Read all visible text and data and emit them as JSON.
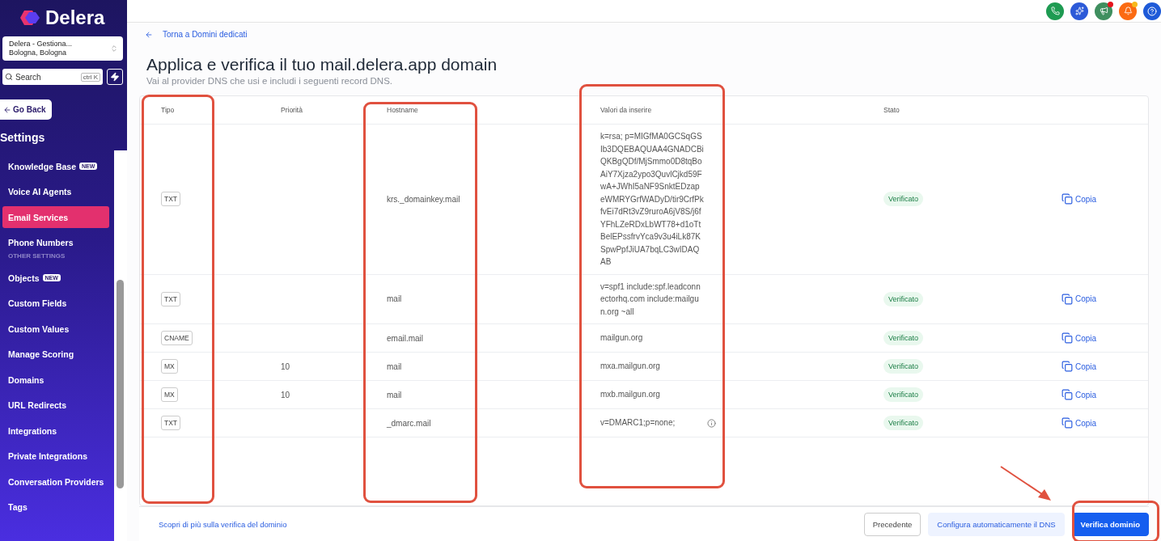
{
  "sidebar": {
    "brand": "Delera",
    "location": {
      "name": "Delera - Gestiona...",
      "city": "Bologna, Bologna"
    },
    "search": {
      "placeholder": "Search",
      "shortcut": "ctrl K"
    },
    "back_button": "Go Back",
    "heading": "Settings",
    "items": [
      {
        "kind": "item",
        "label": "Knowledge Base",
        "badge": "NEW",
        "selected": false
      },
      {
        "kind": "item",
        "label": "Voice AI Agents",
        "selected": false
      },
      {
        "kind": "item",
        "label": "Email Services",
        "selected": true
      },
      {
        "kind": "item",
        "label": "Phone Numbers",
        "selected": false
      },
      {
        "kind": "section",
        "label": "OTHER SETTINGS"
      },
      {
        "kind": "item",
        "label": "Objects",
        "badge": "NEW",
        "selected": false
      },
      {
        "kind": "item",
        "label": "Custom Fields",
        "selected": false
      },
      {
        "kind": "item",
        "label": "Custom Values",
        "selected": false
      },
      {
        "kind": "item",
        "label": "Manage Scoring",
        "selected": false
      },
      {
        "kind": "item",
        "label": "Domains",
        "selected": false
      },
      {
        "kind": "item",
        "label": "URL Redirects",
        "selected": false
      },
      {
        "kind": "item",
        "label": "Integrations",
        "selected": false
      },
      {
        "kind": "item",
        "label": "Private Integrations",
        "selected": false
      },
      {
        "kind": "item",
        "label": "Conversation Providers",
        "selected": false
      },
      {
        "kind": "item",
        "label": "Tags",
        "selected": false
      }
    ]
  },
  "main": {
    "back_link": "Torna a Domini dedicati",
    "title": "Applica e verifica il tuo mail.delera.app domain",
    "subtitle": "Vai al provider DNS che usi e includi i seguenti record DNS.",
    "table": {
      "columns": [
        "Tipo",
        "Priorità",
        "Hostname",
        "Valori da inserire",
        "Stato"
      ],
      "rows": [
        {
          "type": "TXT",
          "priority": "",
          "hostname": "krs._domainkey.mail",
          "value": "k=rsa; p=MIGfMA0GCSqGSIb3DQEBAQUAA4GNADCBiQKBgQDf/MjSmmo0D8tqBoAiY7Xjza2ypo3QuvlCjkd59FwA+JWhI5aNF9SnktEDzapeWMRYGrfWADyD/tir9CrfPkfvEi7dRt3vZ9ruroA6jV8S/j6fYFhLZeRDxLbWT78+d1oTtBelEPssfrvYca9v3u4iLk87KSpwPpfJiUA7bqLC3wIDAQAB",
          "status": "Verificato",
          "copy": "Copia",
          "info": false
        },
        {
          "type": "TXT",
          "priority": "",
          "hostname": "mail",
          "value": "v=spf1 include:spf.leadconnectorhq.com include:mailgun.org ~all",
          "status": "Verificato",
          "copy": "Copia",
          "info": false
        },
        {
          "type": "CNAME",
          "priority": "",
          "hostname": "email.mail",
          "value": "mailgun.org",
          "status": "Verificato",
          "copy": "Copia",
          "info": false
        },
        {
          "type": "MX",
          "priority": "10",
          "hostname": "mail",
          "value": "mxa.mailgun.org",
          "status": "Verificato",
          "copy": "Copia",
          "info": false
        },
        {
          "type": "MX",
          "priority": "10",
          "hostname": "mail",
          "value": "mxb.mailgun.org",
          "status": "Verificato",
          "copy": "Copia",
          "info": false
        },
        {
          "type": "TXT",
          "priority": "",
          "hostname": "_dmarc.mail",
          "value": "v=DMARC1;p=none;",
          "status": "Verificato",
          "copy": "Copia",
          "info": true
        }
      ]
    }
  },
  "footer": {
    "link": "Scopri di più sulla verifica del dominio",
    "buttons": [
      {
        "label": "Precedente",
        "kind": "outline"
      },
      {
        "label": "Configura automaticamente il DNS",
        "kind": "soft"
      },
      {
        "label": "Verifica dominio",
        "kind": "primary"
      }
    ]
  }
}
